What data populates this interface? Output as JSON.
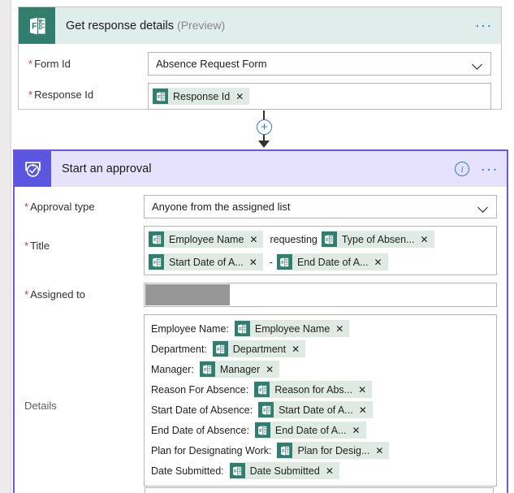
{
  "theme": {
    "forms_brand": "#317E6F",
    "forms_header_bg": "#dfeeea",
    "approval_brand": "#5b56e0",
    "approval_header_bg": "#e6e2fb",
    "approval_border": "#6b58e8",
    "token_bg": "#dfeae5",
    "accent_blue": "#2f7ad4",
    "required_red": "#d6333f",
    "redaction_gray": "#969696"
  },
  "forms_card": {
    "icon": "microsoft-forms-icon",
    "title": "Get response details",
    "title_suffix": "(Preview)",
    "more_label": "...",
    "fields": [
      {
        "label": "Form Id",
        "required": true,
        "type": "dropdown",
        "value": "Absence Request Form"
      },
      {
        "label": "Response Id",
        "required": true,
        "type": "tokens",
        "tokens": [
          {
            "text": "Response Id",
            "icon": "microsoft-forms-icon",
            "remove": "✕"
          }
        ]
      }
    ]
  },
  "connector": {
    "add_label": "+",
    "name": "insert-new-step"
  },
  "approval_card": {
    "icon": "approval-check-icon",
    "title": "Start an approval",
    "info_label": "i",
    "more_label": "...",
    "fields": [
      {
        "label": "Approval type",
        "required": true,
        "type": "dropdown",
        "value": "Anyone from the assigned list"
      },
      {
        "label": "Title",
        "required": true,
        "type": "token-lines",
        "lines": [
          [
            {
              "kind": "token",
              "text": "Employee Name",
              "icon": "microsoft-forms-icon",
              "remove": "✕"
            },
            {
              "kind": "text",
              "text": "requesting"
            },
            {
              "kind": "token",
              "text": "Type of Absen...",
              "icon": "microsoft-forms-icon",
              "remove": "✕"
            }
          ],
          [
            {
              "kind": "token",
              "text": "Start Date of A...",
              "icon": "microsoft-forms-icon",
              "remove": "✕"
            },
            {
              "kind": "text",
              "text": "-"
            },
            {
              "kind": "token",
              "text": "End Date of A...",
              "icon": "microsoft-forms-icon",
              "remove": "✕"
            }
          ]
        ]
      },
      {
        "label": "Assigned to",
        "required": true,
        "type": "redacted",
        "value": ""
      },
      {
        "label": "Details",
        "required": false,
        "type": "details",
        "rows": [
          {
            "label": "Employee Name:",
            "token": "Employee Name",
            "icon": "microsoft-forms-icon",
            "remove": "✕"
          },
          {
            "label": "Department:",
            "token": "Department",
            "icon": "microsoft-forms-icon",
            "remove": "✕"
          },
          {
            "label": "Manager:",
            "token": "Manager",
            "icon": "microsoft-forms-icon",
            "remove": "✕"
          },
          {
            "label": "Reason For Absence:",
            "token": "Reason for Abs...",
            "icon": "microsoft-forms-icon",
            "remove": "✕"
          },
          {
            "label": "Start Date of Absence:",
            "token": "Start Date of A...",
            "icon": "microsoft-forms-icon",
            "remove": "✕"
          },
          {
            "label": "End Date of Absence:",
            "token": "End Date of A...",
            "icon": "microsoft-forms-icon",
            "remove": "✕"
          },
          {
            "label": "Plan for Designating Work:",
            "token": "Plan for Desig...",
            "icon": "microsoft-forms-icon",
            "remove": "✕"
          },
          {
            "label": "Date Submitted:",
            "token": "Date Submitted",
            "icon": "microsoft-forms-icon",
            "remove": "✕"
          }
        ]
      }
    ]
  }
}
